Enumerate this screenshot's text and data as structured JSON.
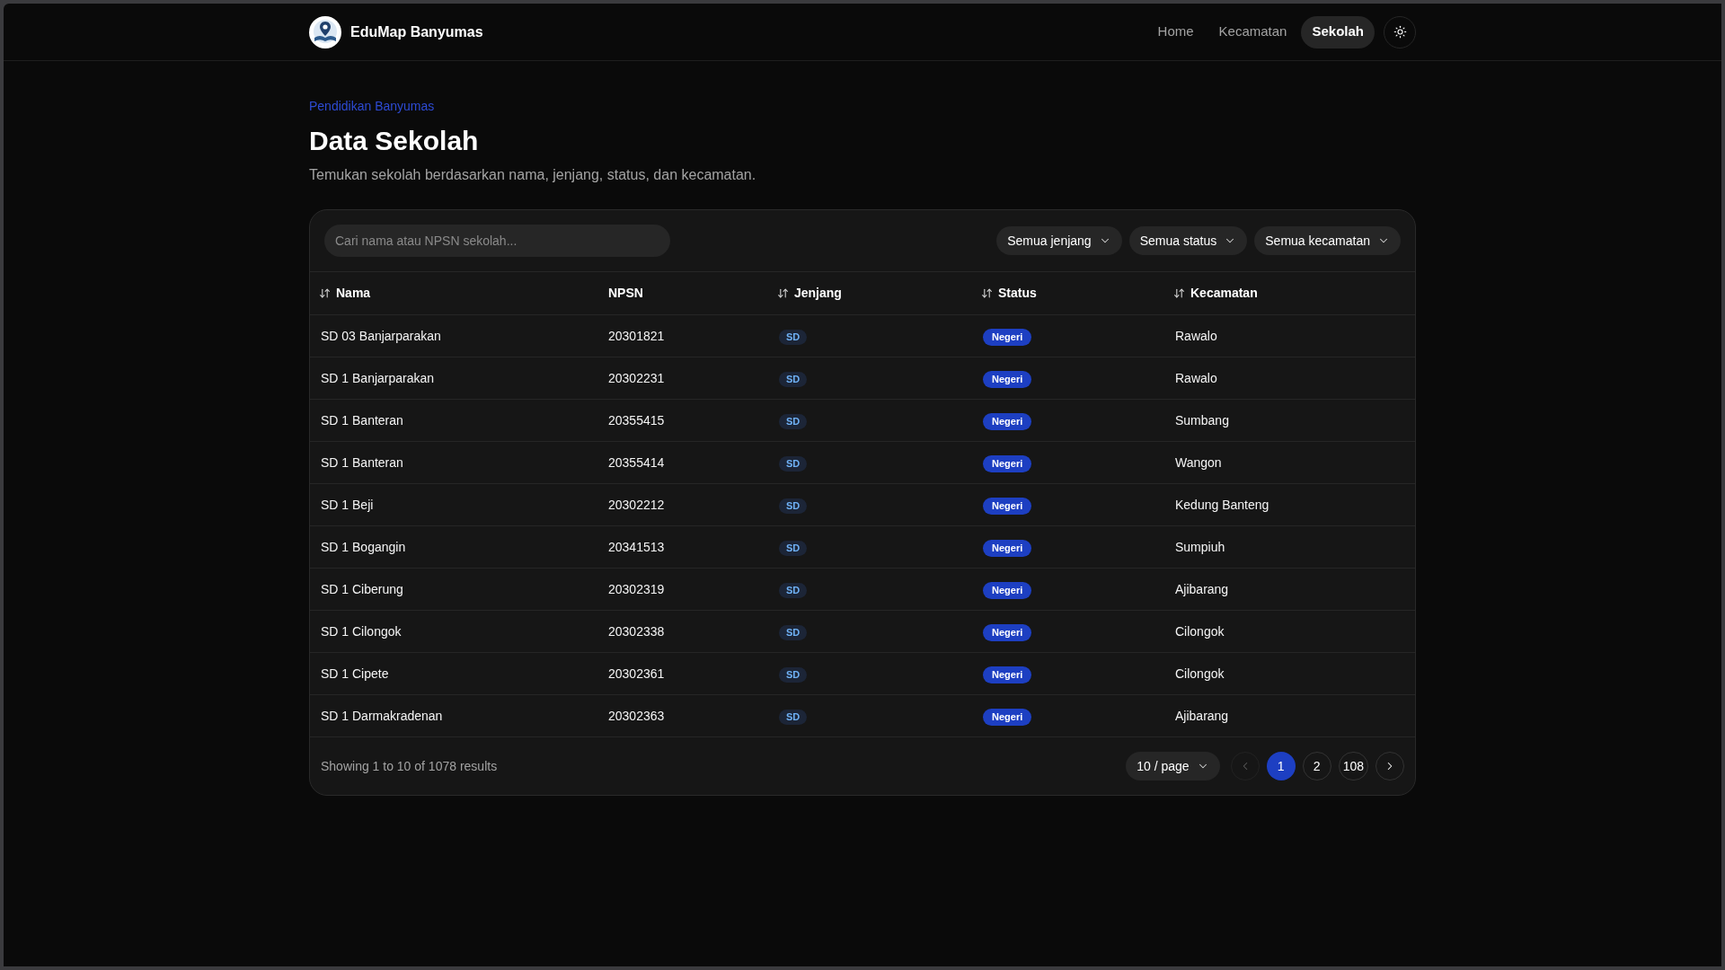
{
  "navbar": {
    "brand": "EduMap Banyumas",
    "links": [
      {
        "label": "Home",
        "selected": false
      },
      {
        "label": "Kecamatan",
        "selected": false
      },
      {
        "label": "Sekolah",
        "selected": true
      }
    ]
  },
  "page_header": {
    "eyebrow": "Pendidikan Banyumas",
    "title": "Data Sekolah",
    "subtitle": "Temukan sekolah berdasarkan nama, jenjang, status, dan kecamatan."
  },
  "filters": {
    "search": {
      "placeholder": "Cari nama atau NPSN sekolah..."
    },
    "dropdowns": [
      "Semua jenjang",
      "Semua status",
      "Semua kecamatan"
    ]
  },
  "table": {
    "columns": [
      {
        "label": "Nama",
        "sortable": true
      },
      {
        "label": "NPSN",
        "sortable": false
      },
      {
        "label": "Jenjang",
        "sortable": true
      },
      {
        "label": "Status",
        "sortable": true
      },
      {
        "label": "Kecamatan",
        "sortable": true
      }
    ],
    "rows": [
      {
        "nama": "SD 03 Banjarparakan",
        "npsn": "20301821",
        "jenjang": "SD",
        "status": "Negeri",
        "kecamatan": "Rawalo"
      },
      {
        "nama": "SD 1 Banjarparakan",
        "npsn": "20302231",
        "jenjang": "SD",
        "status": "Negeri",
        "kecamatan": "Rawalo"
      },
      {
        "nama": "SD 1 Banteran",
        "npsn": "20355415",
        "jenjang": "SD",
        "status": "Negeri",
        "kecamatan": "Sumbang"
      },
      {
        "nama": "SD 1 Banteran",
        "npsn": "20355414",
        "jenjang": "SD",
        "status": "Negeri",
        "kecamatan": "Wangon"
      },
      {
        "nama": "SD 1 Beji",
        "npsn": "20302212",
        "jenjang": "SD",
        "status": "Negeri",
        "kecamatan": "Kedung Banteng"
      },
      {
        "nama": "SD 1 Bogangin",
        "npsn": "20341513",
        "jenjang": "SD",
        "status": "Negeri",
        "kecamatan": "Sumpiuh"
      },
      {
        "nama": "SD 1 Ciberung",
        "npsn": "20302319",
        "jenjang": "SD",
        "status": "Negeri",
        "kecamatan": "Ajibarang"
      },
      {
        "nama": "SD 1 Cilongok",
        "npsn": "20302338",
        "jenjang": "SD",
        "status": "Negeri",
        "kecamatan": "Cilongok"
      },
      {
        "nama": "SD 1 Cipete",
        "npsn": "20302361",
        "jenjang": "SD",
        "status": "Negeri",
        "kecamatan": "Cilongok"
      },
      {
        "nama": "SD 1 Darmakradenan",
        "npsn": "20302363",
        "jenjang": "SD",
        "status": "Negeri",
        "kecamatan": "Ajibarang"
      }
    ]
  },
  "footer": {
    "summary": "Showing 1 to 10 of 1078 results",
    "page_size": "10 / page",
    "pagination": {
      "previous": {
        "disabled": true
      },
      "pages": [
        {
          "label": "1",
          "selected": true
        },
        {
          "label": "2",
          "selected": false
        },
        {
          "label": "108",
          "selected": false
        }
      ],
      "next": {
        "disabled": false
      }
    }
  }
}
